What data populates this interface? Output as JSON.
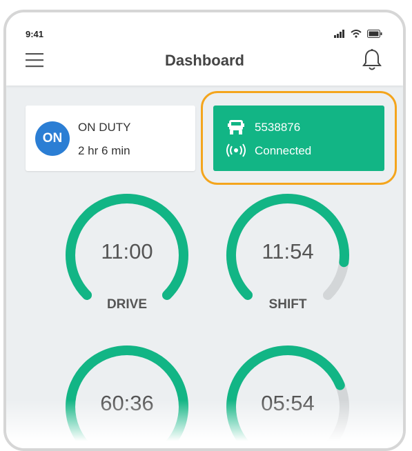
{
  "status_bar": {
    "time": "9:41"
  },
  "header": {
    "title": "Dashboard"
  },
  "duty": {
    "badge": "ON",
    "status": "ON DUTY",
    "elapsed": "2 hr 6 min",
    "badge_color": "#2b7ed4"
  },
  "vehicle": {
    "id": "5538876",
    "connection": "Connected",
    "card_color": "#12b585",
    "highlight_color": "#f4a51d"
  },
  "gauges": [
    {
      "value": "11:00",
      "label": "DRIVE",
      "fill": 1.0
    },
    {
      "value": "11:54",
      "label": "SHIFT",
      "fill": 0.86
    },
    {
      "value": "60:36",
      "label": "",
      "fill": 1.0
    },
    {
      "value": "05:54",
      "label": "",
      "fill": 0.75
    }
  ],
  "colors": {
    "accent": "#12b585",
    "track": "#d3d6d8"
  }
}
